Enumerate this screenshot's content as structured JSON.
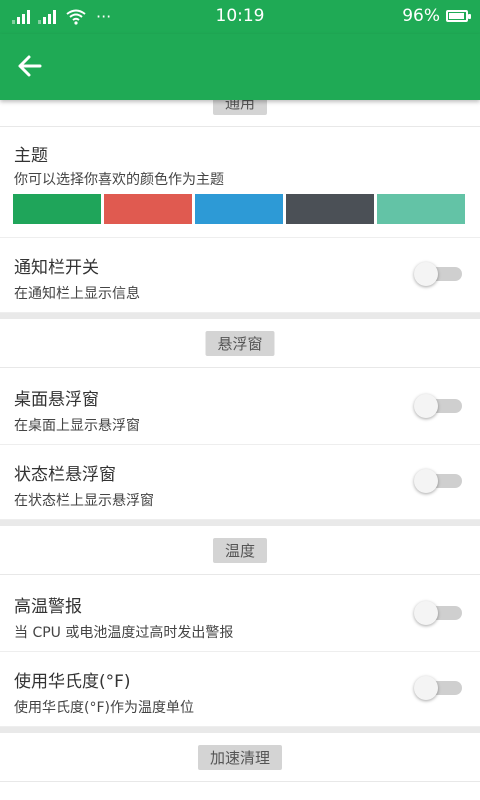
{
  "status_bar": {
    "time": "10:19",
    "battery_percent": "96%",
    "battery_level": 0.96,
    "more": "···"
  },
  "app_bar": {
    "back_icon": "arrow-left-icon"
  },
  "sections": {
    "general": {
      "label": "通用",
      "theme": {
        "title": "主题",
        "subtitle": "你可以选择你喜欢的颜色作为主题",
        "swatches": [
          "#1fa55a",
          "#e05a50",
          "#2d9ad6",
          "#4b5056",
          "#63c3a6"
        ]
      },
      "notification": {
        "title": "通知栏开关",
        "subtitle": "在通知栏上显示信息",
        "enabled": false
      }
    },
    "float_window": {
      "label": "悬浮窗",
      "desktop": {
        "title": "桌面悬浮窗",
        "subtitle": "在桌面上显示悬浮窗",
        "enabled": false
      },
      "statusbar": {
        "title": "状态栏悬浮窗",
        "subtitle": "在状态栏上显示悬浮窗",
        "enabled": false
      }
    },
    "temperature": {
      "label": "温度",
      "high_alert": {
        "title": "高温警报",
        "subtitle": "当 CPU 或电池温度过高时发出警报",
        "enabled": false
      },
      "fahrenheit": {
        "title": "使用华氏度(°F)",
        "subtitle": "使用华氏度(°F)作为温度单位",
        "enabled": false
      }
    },
    "cleanup": {
      "label": "加速清理"
    }
  },
  "colors": {
    "primary": "#1faa55"
  }
}
